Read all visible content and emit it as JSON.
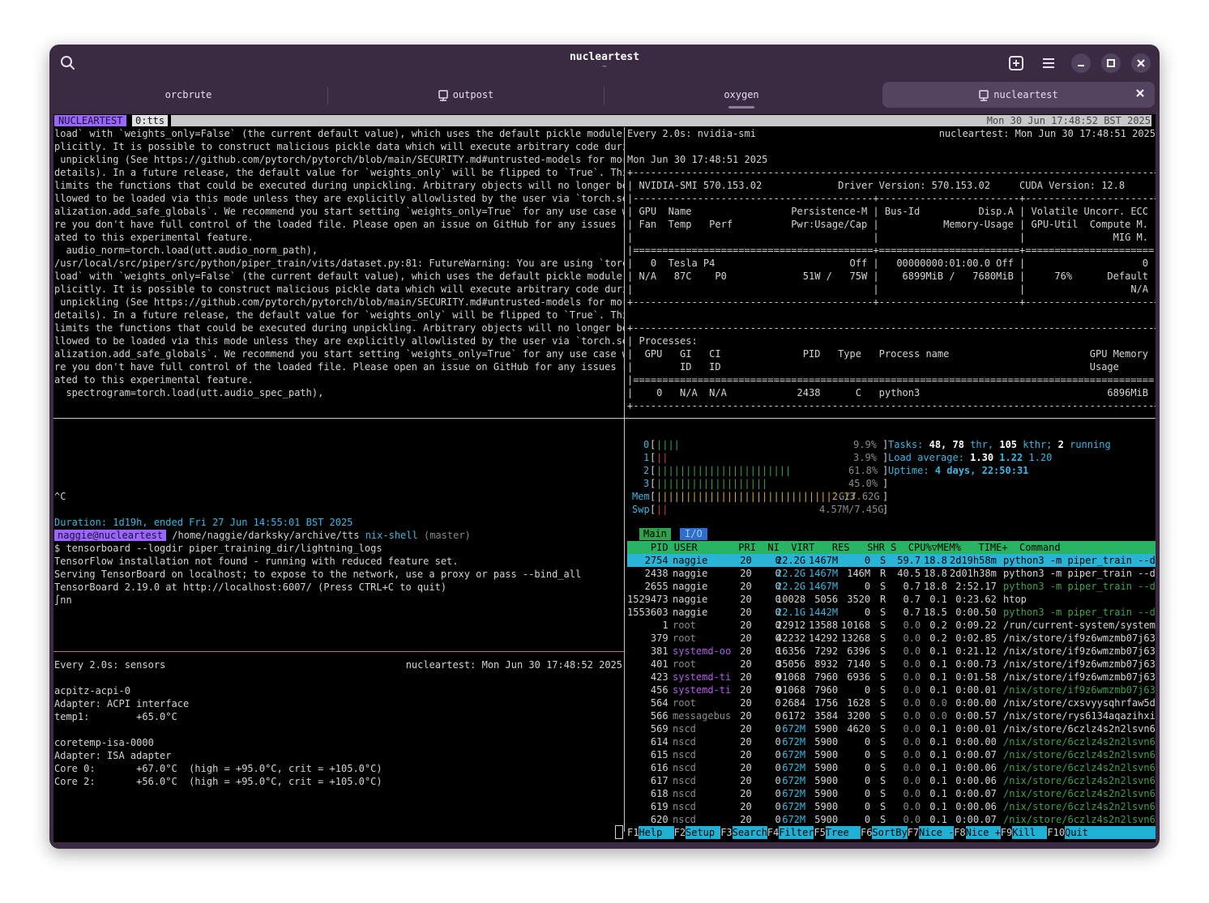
{
  "window": {
    "title": "nucleartest",
    "subtitle": "~"
  },
  "tabs": [
    {
      "label": "orcbrute"
    },
    {
      "label": "outpost"
    },
    {
      "label": "oxygen"
    },
    {
      "label": "nucleartest"
    }
  ],
  "tmux": {
    "session": "NUCLEARTEST",
    "window": "0:tts",
    "clock": "Mon 30 Jun 17:48:52 BST 2025"
  },
  "log_pane": {
    "lines": [
      "load` with `weights_only=False` (the current default value), which uses the default pickle module im",
      "plicitly. It is possible to construct malicious pickle data which will execute arbitrary code during",
      " unpickling (See https://github.com/pytorch/pytorch/blob/main/SECURITY.md#untrusted-models for more",
      "details). In a future release, the default value for `weights_only` will be flipped to `True`. This",
      "limits the functions that could be executed during unpickling. Arbitrary objects will no longer be a",
      "llowed to be loaded via this mode unless they are explicitly allowlisted by the user via `torch.seri",
      "alization.add_safe_globals`. We recommend you start setting `weights_only=True` for any use case whe",
      "re you don't have full control of the loaded file. Please open an issue on GitHub for any issues rel",
      "ated to this experimental feature.",
      "  audio_norm=torch.load(utt.audio_norm_path),",
      "/usr/local/src/piper/src/python/piper_train/vits/dataset.py:81: FutureWarning: You are using `torch.",
      "load` with `weights_only=False` (the current default value), which uses the default pickle module im",
      "plicitly. It is possible to construct malicious pickle data which will execute arbitrary code during",
      " unpickling (See https://github.com/pytorch/pytorch/blob/main/SECURITY.md#untrusted-models for more",
      "details). In a future release, the default value for `weights_only` will be flipped to `True`. This",
      "limits the functions that could be executed during unpickling. Arbitrary objects will no longer be a",
      "llowed to be loaded via this mode unless they are explicitly allowlisted by the user via `torch.seri",
      "alization.add_safe_globals`. We recommend you start setting `weights_only=True` for any use case whe",
      "re you don't have full control of the loaded file. Please open an issue on GitHub for any issues rel",
      "ated to this experimental feature.",
      "  spectrogram=torch.load(utt.audio_spec_path),"
    ]
  },
  "shell_pane": {
    "ctrl_c": "^C",
    "duration": "Duration: 1d19h, ended Fri 27 Jun 14:55:01 BST 2025",
    "prompt_user": "naggie@nucleartest",
    "prompt_path": "/home/naggie/darksky/archive/tts",
    "prompt_env": "nix-shell",
    "prompt_branch": "(master)",
    "output": [
      "$ tensorboard --logdir piper_training_dir/lightning_logs",
      "TensorFlow installation not found - running with reduced feature set.",
      "Serving TensorBoard on localhost; to expose to the network, use a proxy or pass --bind_all",
      "TensorBoard 2.19.0 at http://localhost:6007/ (Press CTRL+C to quit)",
      "∫nn"
    ]
  },
  "sensors_pane": {
    "header_left": "Every 2.0s: sensors",
    "header_right": "nucleartest: Mon Jun 30 17:48:52 2025",
    "lines": [
      "acpitz-acpi-0",
      "Adapter: ACPI interface",
      "temp1:        +65.0°C",
      "",
      "coretemp-isa-0000",
      "Adapter: ISA adapter",
      "Core 0:       +67.0°C  (high = +95.0°C, crit = +105.0°C)",
      "Core 2:       +56.0°C  (high = +95.0°C, crit = +105.0°C)"
    ]
  },
  "nvidia_pane": {
    "header_left": "Every 2.0s: nvidia-smi",
    "header_right": "nucleartest: Mon Jun 30 17:48:51 2025",
    "lines": [
      "Mon Jun 30 17:48:51 2025",
      "+-----------------------------------------------------------------------------------------+",
      "| NVIDIA-SMI 570.153.02             Driver Version: 570.153.02     CUDA Version: 12.8     |",
      "|-----------------------------------------+------------------------+----------------------+",
      "| GPU  Name                 Persistence-M | Bus-Id          Disp.A | Volatile Uncorr. ECC |",
      "| Fan  Temp   Perf          Pwr:Usage/Cap |           Memory-Usage | GPU-Util  Compute M. |",
      "|                                         |                        |               MIG M. |",
      "|=========================================+========================+======================|",
      "|   0  Tesla P4                       Off |   00000000:01:00.0 Off |                    0 |",
      "| N/A   87C    P0             51W /   75W |    6899MiB /   7680MiB |     76%      Default |",
      "|                                         |                        |                  N/A |",
      "+-----------------------------------------+------------------------+----------------------+",
      "",
      "+-----------------------------------------------------------------------------------------+",
      "| Processes:                                                                              |",
      "|  GPU   GI   CI              PID   Type   Process name                        GPU Memory |",
      "|        ID   ID                                                               Usage      |",
      "|=========================================================================================|",
      "|    0   N/A  N/A            2438      C   python3                                6896MiB |",
      "+-----------------------------------------------------------------------------------------+"
    ]
  },
  "htop": {
    "cpus": [
      {
        "label": "0",
        "bars": "||||",
        "pct": "9.9%",
        "value": 9.9
      },
      {
        "label": "1",
        "bars": "||",
        "pct": "3.9%",
        "value": 3.9
      },
      {
        "label": "2",
        "bars": "|||||||||||||||||||||||",
        "pct": "61.8%",
        "value": 61.8
      },
      {
        "label": "3",
        "bars": "|||||||||||||||||||",
        "pct": "45.0%",
        "value": 45.0
      }
    ],
    "mem": {
      "label": "Mem",
      "bars": "||||||||||||||||||||||||||||||2.13",
      "usage": "G/7.62G"
    },
    "swp": {
      "label": "Swp",
      "bars": "||",
      "usage": "4.57M/7.45G"
    },
    "tasks_label": "Tasks:",
    "tasks_procs": "48,",
    "tasks_thr": "78",
    "tasks_thr_label": "thr,",
    "tasks_kthr": "105",
    "tasks_kthr_label": "kthr;",
    "tasks_running": "2",
    "tasks_running_label": "running",
    "load_label": "Load average:",
    "load1": "1.30",
    "load5": "1.22",
    "load15": "1.20",
    "uptime_label": "Uptime:",
    "uptime": "4 days, 22:50:31",
    "tab_main": "Main",
    "tab_io": "I/O",
    "header": "    PID USER       PRI  NI  VIRT   RES   SHR S  CPU%▽MEM%   TIME+  Command",
    "rows": [
      [
        "   2754",
        "naggie    ",
        " 20",
        "  0",
        "22.2G",
        "1467M",
        "    0",
        "S",
        " 59.7",
        "18.8",
        "2d19h58m",
        "python3 -m piper_train --d"
      ],
      [
        "   2438",
        "naggie    ",
        " 20",
        "  0",
        "22.2G",
        "1467M",
        " 146M",
        "R",
        " 40.5",
        "18.8",
        "2d01h38m",
        "python3 -m piper_train --d"
      ],
      [
        "   2655",
        "naggie    ",
        " 20",
        "  0",
        "22.2G",
        "1467M",
        "    0",
        "S",
        "  0.7",
        "18.8",
        " 2:52.17",
        "python3 -m piper_train --d"
      ],
      [
        "1529473",
        "naggie    ",
        " 20",
        "  0",
        "10028",
        " 5056",
        " 3520",
        "R",
        "  0.7",
        " 0.1",
        " 0:23.62",
        "htop"
      ],
      [
        "1553603",
        "naggie    ",
        " 20",
        "  0",
        "22.1G",
        "1442M",
        "    0",
        "S",
        "  0.7",
        "18.5",
        " 0:00.50",
        "python3 -m piper_train --d"
      ],
      [
        "      1",
        "root      ",
        " 20",
        "  0",
        "22912",
        "13588",
        "10168",
        "S",
        "  0.0",
        " 0.2",
        " 0:09.22",
        "/run/current-system/system"
      ],
      [
        "    379",
        "root      ",
        " 20",
        "  0",
        "42232",
        "14292",
        "13268",
        "S",
        "  0.0",
        " 0.2",
        " 0:02.85",
        "/nix/store/if9z6wmzmb07j63"
      ],
      [
        "    381",
        "systemd-oo",
        " 20",
        "  0",
        "16356",
        " 7292",
        " 6396",
        "S",
        "  0.0",
        " 0.1",
        " 0:21.12",
        "/nix/store/if9z6wmzmb07j63"
      ],
      [
        "    401",
        "root      ",
        " 20",
        "  0",
        "35056",
        " 8932",
        " 7140",
        "S",
        "  0.0",
        " 0.1",
        " 0:00.73",
        "/nix/store/if9z6wmzmb07j63"
      ],
      [
        "    423",
        "systemd-ti",
        " 20",
        "  0",
        "91068",
        " 7960",
        " 6936",
        "S",
        "  0.0",
        " 0.1",
        " 0:01.58",
        "/nix/store/if9z6wmzmb07j63"
      ],
      [
        "    456",
        "systemd-ti",
        " 20",
        "  0",
        "91068",
        " 7960",
        "    0",
        "S",
        "  0.0",
        " 0.1",
        " 0:00.01",
        "/nix/store/if9z6wmzmb07j63"
      ],
      [
        "    564",
        "root      ",
        " 20",
        "  0",
        " 2684",
        " 1756",
        " 1628",
        "S",
        "  0.0",
        " 0.0",
        " 0:00.00",
        "/nix/store/cxsvyysqhrfaw5d"
      ],
      [
        "    566",
        "messagebus",
        " 20",
        "  0",
        " 6172",
        " 3584",
        " 3200",
        "S",
        "  0.0",
        " 0.0",
        " 0:00.57",
        "/nix/store/rys6134aqazihxi"
      ],
      [
        "    569",
        "nscd      ",
        " 20",
        "  0",
        " 672M",
        " 5900",
        " 4620",
        "S",
        "  0.0",
        " 0.1",
        " 0:00.01",
        "/nix/store/6czlz4s2n2lsvn6"
      ],
      [
        "    614",
        "nscd      ",
        " 20",
        "  0",
        " 672M",
        " 5900",
        "    0",
        "S",
        "  0.0",
        " 0.1",
        " 0:00.00",
        "/nix/store/6czlz4s2n2lsvn6"
      ],
      [
        "    615",
        "nscd      ",
        " 20",
        "  0",
        " 672M",
        " 5900",
        "    0",
        "S",
        "  0.0",
        " 0.1",
        " 0:00.07",
        "/nix/store/6czlz4s2n2lsvn6"
      ],
      [
        "    616",
        "nscd      ",
        " 20",
        "  0",
        " 672M",
        " 5900",
        "    0",
        "S",
        "  0.0",
        " 0.1",
        " 0:00.06",
        "/nix/store/6czlz4s2n2lsvn6"
      ],
      [
        "    617",
        "nscd      ",
        " 20",
        "  0",
        " 672M",
        " 5900",
        "    0",
        "S",
        "  0.0",
        " 0.1",
        " 0:00.06",
        "/nix/store/6czlz4s2n2lsvn6"
      ],
      [
        "    618",
        "nscd      ",
        " 20",
        "  0",
        " 672M",
        " 5900",
        "    0",
        "S",
        "  0.0",
        " 0.1",
        " 0:00.07",
        "/nix/store/6czlz4s2n2lsvn6"
      ],
      [
        "    619",
        "nscd      ",
        " 20",
        "  0",
        " 672M",
        " 5900",
        "    0",
        "S",
        "  0.0",
        " 0.1",
        " 0:00.06",
        "/nix/store/6czlz4s2n2lsvn6"
      ],
      [
        "    620",
        "nscd      ",
        " 20",
        "  0",
        " 672M",
        " 5900",
        "    0",
        "S",
        "  0.0",
        " 0.1",
        " 0:00.07",
        "/nix/store/6czlz4s2n2lsvn6"
      ]
    ],
    "fkeys": [
      {
        "key": "F1",
        "label": "Help  "
      },
      {
        "key": "F2",
        "label": "Setup "
      },
      {
        "key": "F3",
        "label": "Search"
      },
      {
        "key": "F4",
        "label": "Filter"
      },
      {
        "key": "F5",
        "label": "Tree  "
      },
      {
        "key": "F6",
        "label": "SortBy"
      },
      {
        "key": "F7",
        "label": "Nice -"
      },
      {
        "key": "F8",
        "label": "Nice +"
      },
      {
        "key": "F9",
        "label": "Kill  "
      },
      {
        "key": "F10",
        "label": "Quit  "
      }
    ]
  },
  "colors": {
    "titlebar": "#3a2b42",
    "accent": "#9b66ff",
    "htop_header": "#28b463",
    "htop_selected": "#29b3d6"
  }
}
